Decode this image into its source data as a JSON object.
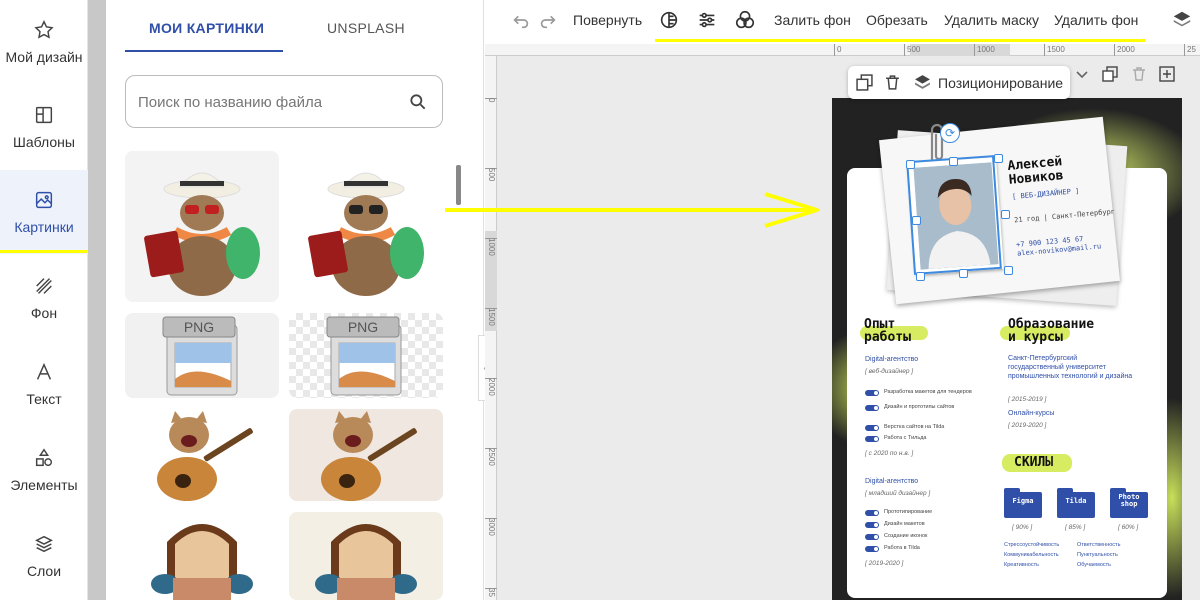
{
  "sidebar": {
    "items": [
      {
        "label": "Мой дизайн",
        "icon": "star-icon"
      },
      {
        "label": "Шаблоны",
        "icon": "templates-icon"
      },
      {
        "label": "Картинки",
        "icon": "image-icon",
        "active": true
      },
      {
        "label": "Фон",
        "icon": "background-icon"
      },
      {
        "label": "Текст",
        "icon": "text-icon"
      },
      {
        "label": "Элементы",
        "icon": "elements-icon"
      },
      {
        "label": "Слои",
        "icon": "layers-icon"
      }
    ]
  },
  "panel": {
    "tabs": [
      {
        "label": "МОИ КАРТИНКИ",
        "active": true
      },
      {
        "label": "UNSPLASH"
      }
    ],
    "search": {
      "placeholder": "Поиск по названию файла",
      "value": ""
    },
    "png_label": "PNG",
    "images": [
      {
        "subject": "cat-traveler",
        "background": "solid"
      },
      {
        "subject": "cat-traveler",
        "background": "transparent"
      },
      {
        "subject": "png-file-icon",
        "background": "solid"
      },
      {
        "subject": "png-file-icon",
        "background": "transparent"
      },
      {
        "subject": "cat-guitar",
        "background": "transparent"
      },
      {
        "subject": "cat-guitar",
        "background": "solid"
      },
      {
        "subject": "armchair",
        "background": "transparent"
      },
      {
        "subject": "armchair",
        "background": "solid"
      }
    ]
  },
  "toolbar": {
    "undo_icon": "undo-icon",
    "redo_icon": "redo-icon",
    "rotate": "Повернуть",
    "fill_bg": "Залить фон",
    "crop": "Обрезать",
    "remove_mask": "Удалить маску",
    "remove_bg": "Удалить фон"
  },
  "ruler": {
    "h_ticks": [
      "0",
      "500",
      "1000",
      "1500",
      "2000",
      "25"
    ],
    "v_ticks": [
      "0",
      "500",
      "1000",
      "1500",
      "2000",
      "2500",
      "3000",
      "35"
    ]
  },
  "frame_tools": {
    "positioning": "Позиционирование"
  },
  "resume": {
    "name": "Алексей\nНовиков",
    "role": "[ ВЕБ-ДИЗАЙНЕР ]",
    "city": "21 год | Санкт-Петербург",
    "phone": "+7 900 123 45 67",
    "email": "alex-novikov@mail.ru",
    "experience_title": "Опыт\nработы",
    "education_title": "Образование\nи курсы",
    "skills_title": "СКИЛЫ",
    "jobs": [
      {
        "company": "Digital-агентство",
        "role": "[ веб-дизайнер ]",
        "tasks": [
          "Разработка макетов для тендеров",
          "Дизайн и прототипы сайтов",
          "Верстка сайтов на Tilda",
          "Работа с Тильда"
        ],
        "period": "[ с 2020 по н.в. ]"
      },
      {
        "company": "Digital-агентство",
        "role": "[ младший дизайнер ]",
        "tasks": [
          "Прототипирование",
          "Дизайн макетов",
          "Создание иконок",
          "Работа в Tilda"
        ],
        "period": "[ 2019-2020 ]"
      }
    ],
    "education": [
      {
        "name": "Санкт-Петербургский государственный университет промышленных технологий и дизайна",
        "period": "[ 2015-2019 ]"
      },
      {
        "name": "Онлайн-курсы",
        "period": "[ 2019-2020 ]"
      }
    ],
    "skills": [
      {
        "name": "Figma",
        "level": "[ 90% ]"
      },
      {
        "name": "Tilda",
        "level": "[ 85% ]"
      },
      {
        "name": "Photo shop",
        "level": "[ 60% ]"
      }
    ],
    "soft_skills": [
      "Стрессоустойчивость",
      "Коммуникабельность",
      "Креативность",
      "Ответственность",
      "Пунктуальность",
      "Обучаемость"
    ]
  },
  "colors": {
    "accent": "#2f4fa8",
    "highlight": "#ffff00",
    "lime": "#d8ec62"
  }
}
